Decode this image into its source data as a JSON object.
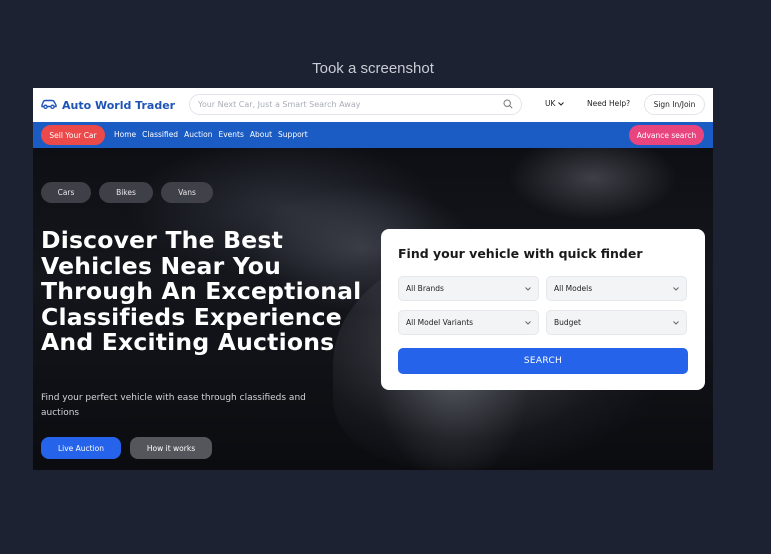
{
  "caption": "Took a screenshot",
  "header": {
    "brand": "Auto World Trader",
    "search_placeholder": "Your Next Car, Just a Smart Search Away",
    "region": "UK",
    "help": "Need Help?",
    "signin": "Sign In/Join"
  },
  "nav": {
    "sell_label": "Sell Your Car",
    "links": [
      "Home",
      "Classified",
      "Auction",
      "Events",
      "About",
      "Support"
    ],
    "advance_label": "Advance search"
  },
  "hero": {
    "chips": [
      "Cars",
      "Bikes",
      "Vans"
    ],
    "headline": "Discover The Best Vehicles Near You Through An Exceptional Classifieds Experience And Exciting Auctions",
    "subtext": "Find your perfect vehicle with ease through classifieds and auctions",
    "live_auction": "Live Auction",
    "how_it_works": "How it works"
  },
  "finder": {
    "title": "Find your vehicle with quick finder",
    "brands": "All Brands",
    "models": "All Models",
    "variants": "All Model Variants",
    "budget": "Budget",
    "search": "SEARCH"
  },
  "colors": {
    "brand_blue": "#1e54b7",
    "nav_blue": "#1a5bc4",
    "sell_red": "#ec4a4a",
    "advance_pink": "#e8457f",
    "primary_button": "#2563eb"
  }
}
